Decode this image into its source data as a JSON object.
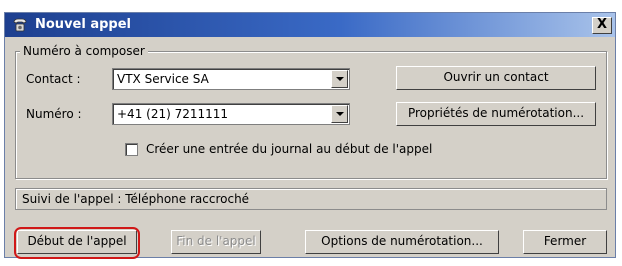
{
  "window": {
    "title": "Nouvel appel",
    "close_label": "X"
  },
  "group": {
    "legend": "Numéro à composer",
    "contact_label": "Contact :",
    "contact_value": "VTX Service SA",
    "numero_label": "Numéro :",
    "numero_value": "+41 (21) 7211111",
    "open_contact_button": "Ouvrir un contact",
    "dialing_properties_button": "Propriétés de numérotation...",
    "journal_checkbox_label": "Créer une entrée du journal au début de l'appel",
    "journal_checked": false
  },
  "status": {
    "text": "Suivi de l'appel : Téléphone raccroché"
  },
  "buttons": {
    "start_call": "Début de l'appel",
    "end_call": "Fin de l'appel",
    "dial_options": "Options de numérotation...",
    "close": "Fermer"
  },
  "colors": {
    "highlight": "#d01818",
    "titlebar_start": "#1d3f8f"
  },
  "icons": {
    "title_icon": "phone-call-icon"
  }
}
